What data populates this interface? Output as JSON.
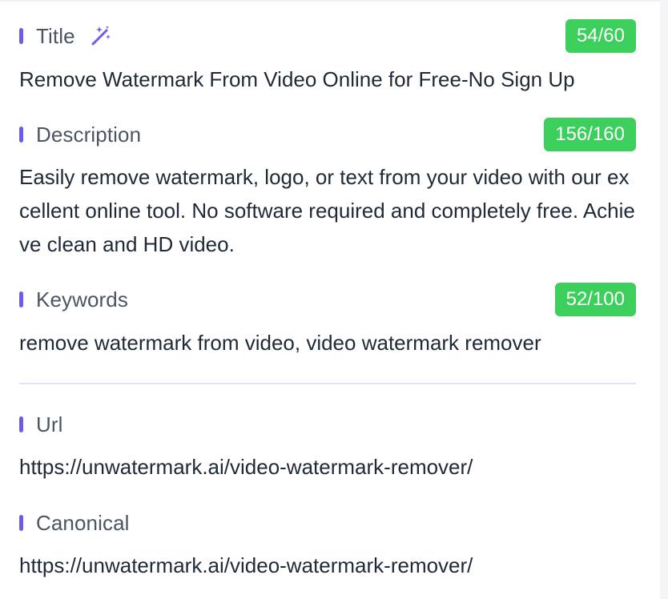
{
  "title": {
    "label": "Title",
    "count": "54/60",
    "value": "Remove Watermark From Video Online for Free-No Sign Up"
  },
  "description": {
    "label": "Description",
    "count": "156/160",
    "value": "Easily remove watermark, logo, or text from your video with our excellent online tool. No software required and completely free. Achieve clean and HD video."
  },
  "keywords": {
    "label": "Keywords",
    "count": "52/100",
    "value": "remove watermark from video, video watermark remover"
  },
  "url": {
    "label": "Url",
    "value": "https://unwatermark.ai/video-watermark-remover/"
  },
  "canonical": {
    "label": "Canonical",
    "value": "https://unwatermark.ai/video-watermark-remover/"
  },
  "colors": {
    "accent_bar": "#6c5ce7",
    "badge_green": "#3ccf5c",
    "divider": "#e1e0f6"
  },
  "icons": {
    "title_action": "magic-wand-icon"
  }
}
